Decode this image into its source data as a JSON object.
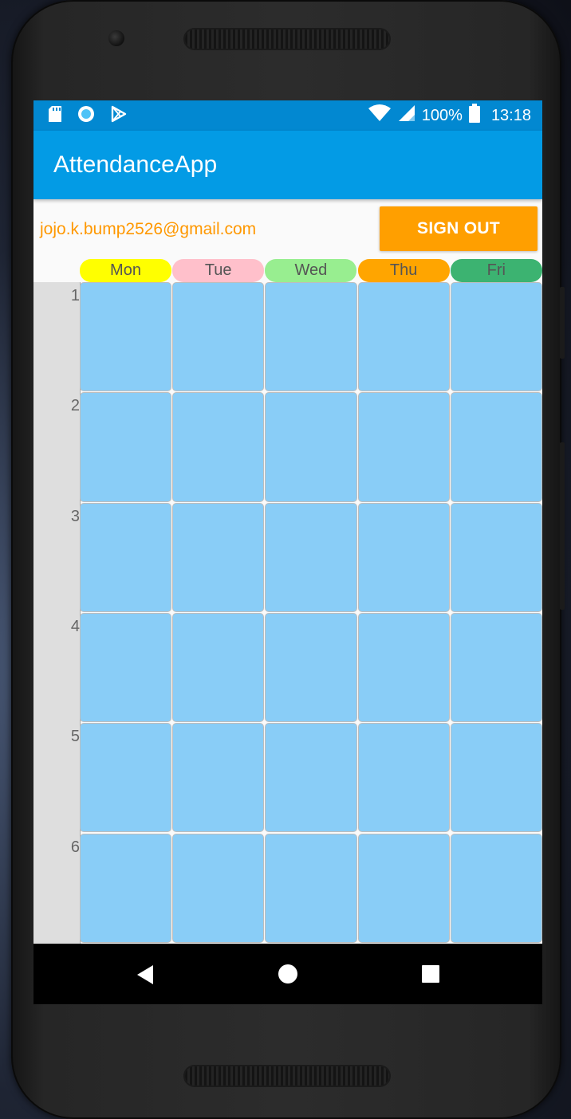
{
  "status_bar": {
    "icons_left": [
      "sd-card-icon",
      "radio-icon",
      "play-store-icon"
    ],
    "battery": "100%",
    "time": "13:18"
  },
  "app_bar": {
    "title": "AttendanceApp"
  },
  "account": {
    "email": "jojo.k.bump2526@gmail.com",
    "sign_out_label": "SIGN OUT"
  },
  "timetable": {
    "days": [
      {
        "label": "Mon",
        "color": "#ffff00"
      },
      {
        "label": "Tue",
        "color": "#ffc0cb"
      },
      {
        "label": "Wed",
        "color": "#98ee90"
      },
      {
        "label": "Thu",
        "color": "#ffa500"
      },
      {
        "label": "Fri",
        "color": "#3cb371"
      }
    ],
    "periods": [
      "1",
      "2",
      "3",
      "4",
      "5",
      "6"
    ],
    "cell_color": "#89cdf7"
  },
  "nav_bar": {
    "buttons": [
      "back-icon",
      "home-icon",
      "recents-icon"
    ]
  },
  "colors": {
    "status_bar": "#0288d1",
    "app_bar": "#039be5",
    "accent": "#ff9800"
  }
}
